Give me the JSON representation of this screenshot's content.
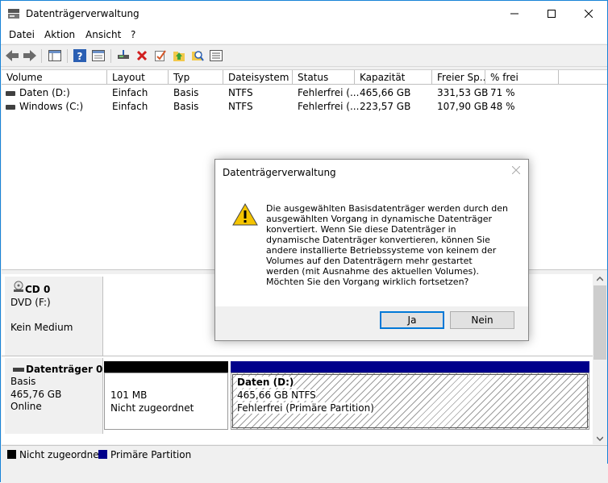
{
  "window": {
    "title": "Datenträgerverwaltung"
  },
  "menu": {
    "items": [
      "Datei",
      "Aktion",
      "Ansicht",
      "?"
    ]
  },
  "volume_list": {
    "columns": [
      "Volume",
      "Layout",
      "Typ",
      "Dateisystem",
      "Status",
      "Kapazität",
      "Freier Sp...",
      "% frei"
    ],
    "rows": [
      {
        "volume": "Daten (D:)",
        "layout": "Einfach",
        "typ": "Basis",
        "fs": "NTFS",
        "status": "Fehlerfrei (...",
        "capacity": "465,66 GB",
        "free": "331,53 GB",
        "pct": "71 %"
      },
      {
        "volume": "Windows (C:)",
        "layout": "Einfach",
        "typ": "Basis",
        "fs": "NTFS",
        "status": "Fehlerfrei (...",
        "capacity": "223,57 GB",
        "free": "107,90 GB",
        "pct": "48 %"
      }
    ]
  },
  "disks": {
    "cd0": {
      "name": "CD 0",
      "line2": "DVD (F:)",
      "line3": "Kein Medium"
    },
    "disk0": {
      "name": "Datenträger 0",
      "type": "Basis",
      "size": "465,76 GB",
      "state": "Online",
      "unallocated": {
        "size": "101 MB",
        "label": "Nicht zugeordnet"
      },
      "primary": {
        "name": "Daten  (D:)",
        "size": "465,66 GB NTFS",
        "status": "Fehlerfrei (Primäre Partition)"
      }
    }
  },
  "legend": {
    "unallocated": "Nicht zugeordnet",
    "primary": "Primäre Partition"
  },
  "dialog": {
    "title": "Datenträgerverwaltung",
    "message": "Die ausgewählten Basisdatenträger werden durch den ausgewählten Vorgang in dynamische Datenträger konvertiert. Wenn Sie diese Datenträger in dynamische Datenträger konvertieren, können Sie andere installierte Betriebssysteme von keinem der Volumes auf den Datenträgern mehr gestartet werden (mit Ausnahme des aktuellen Volumes). Möchten Sie den Vorgang wirklich fortsetzen?",
    "yes": "Ja",
    "no": "Nein"
  },
  "colors": {
    "unallocated": "#000000",
    "primary": "#00008b",
    "accent": "#0078d7"
  }
}
